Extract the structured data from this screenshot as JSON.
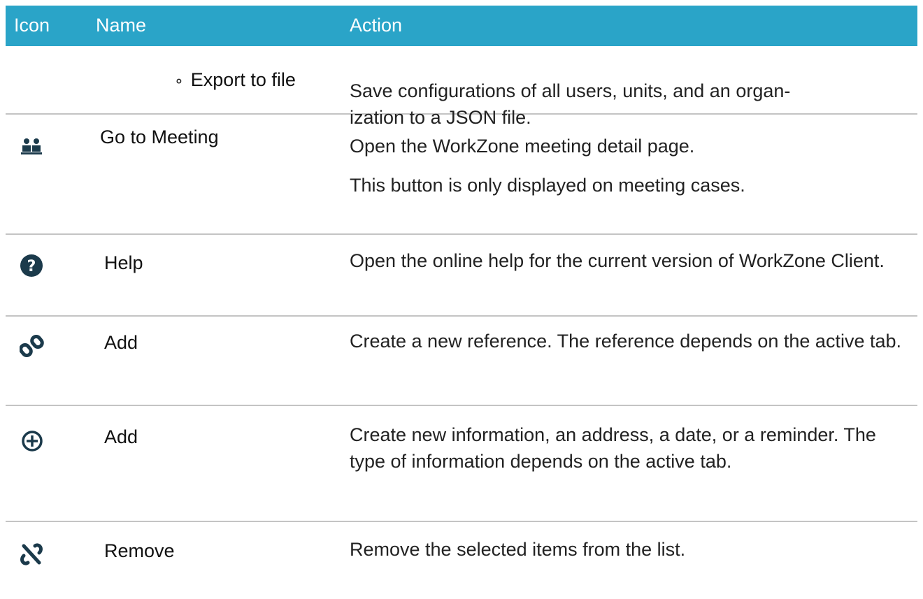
{
  "header": {
    "icon": "Icon",
    "name": "Name",
    "action": "Action"
  },
  "rows": [
    {
      "icon": "none",
      "name": "Export to file",
      "bullet": "∘",
      "action": [
        "Save configurations of all users, units, and an organ-\nization to a JSON file."
      ]
    },
    {
      "icon": "meeting-icon",
      "name": "Go to Meeting",
      "action": [
        "Open the WorkZone meeting detail page.",
        "This button is only displayed on meeting cases."
      ]
    },
    {
      "icon": "help-icon",
      "name": "Help",
      "action": [
        "Open the online help for the current version of WorkZone Client."
      ]
    },
    {
      "icon": "link-icon",
      "name": "Add",
      "action": [
        "Create a new reference. The reference depends on the active tab."
      ]
    },
    {
      "icon": "plus-circle-icon",
      "name": "Add",
      "action": [
        "Create new information, an address, a date, or a reminder. The type of information depends on the active tab."
      ]
    },
    {
      "icon": "unlink-icon",
      "name": "Remove",
      "action": [
        "Remove the selected items from the list."
      ]
    }
  ],
  "colors": {
    "header_bg": "#2aa4c8",
    "icon": "#1b3a4b",
    "divider": "#c4c4c4"
  }
}
